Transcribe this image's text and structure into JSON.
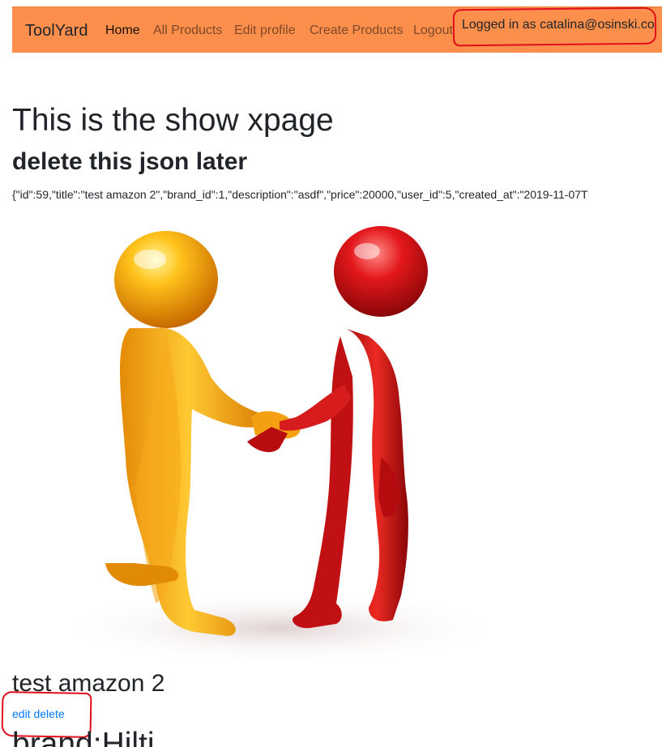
{
  "navbar": {
    "brand": "ToolYard",
    "links": [
      {
        "label": "Home"
      },
      {
        "label": "All Products"
      },
      {
        "label": "Edit profile"
      },
      {
        "label": "Create Products"
      },
      {
        "label": "Logout"
      }
    ],
    "login_status": "Logged in as catalina@osinski.co"
  },
  "main": {
    "heading": "This is the show xpage",
    "subheading": "delete this json later",
    "json_text": "{\"id\":59,\"title\":\"test amazon 2\",\"brand_id\":1,\"description\":\"asdf\",\"price\":20000,\"user_id\":5,\"created_at\":\"2019-11-07T",
    "product_title": "test amazon 2",
    "edit_link": "edit",
    "delete_link": "delete",
    "brand_line": "brand:Hilti"
  },
  "colors": {
    "navbar_bg": "#fd8f4c",
    "annotation_red": "#e00f1b",
    "link_blue": "#007bff"
  }
}
